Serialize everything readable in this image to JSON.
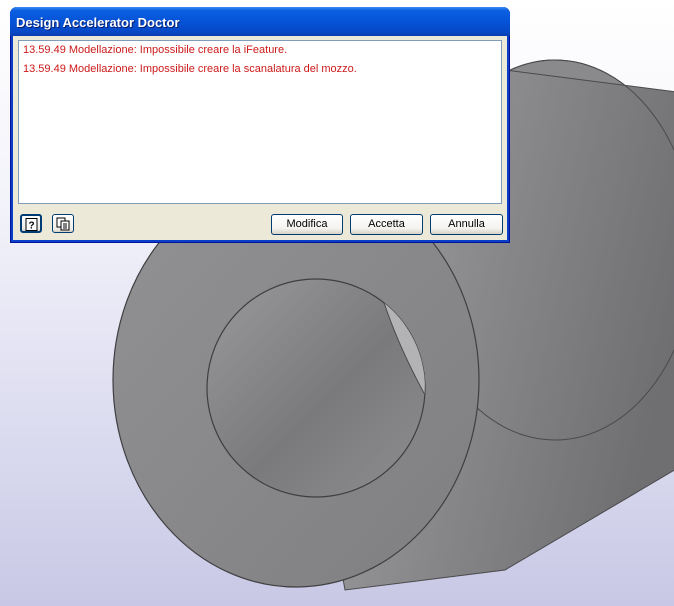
{
  "dialog": {
    "title": "Design Accelerator Doctor",
    "messages": [
      "13.59.49 Modellazione: Impossibile creare la iFeature.",
      "13.59.49 Modellazione: Impossibile creare la scanalatura del mozzo."
    ],
    "message_color": "#cc1a1a",
    "buttons": {
      "modify": "Modifica",
      "accept": "Accetta",
      "cancel": "Annulla"
    },
    "icons": [
      "help-icon",
      "copy-icon"
    ]
  },
  "colors": {
    "titlebar": "#0653d8",
    "dialog_face": "#ece9d8",
    "part_gray": "#8a8a8c"
  }
}
